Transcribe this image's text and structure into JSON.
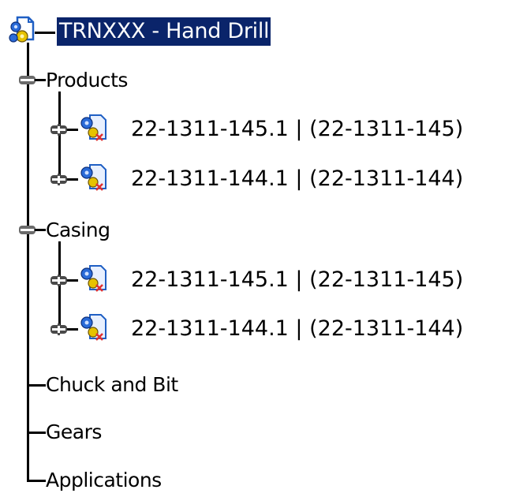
{
  "root": {
    "label": "TRNXXX - Hand Drill",
    "icon": "product-document-icon",
    "selected": true
  },
  "nodes": [
    {
      "label": "Products",
      "expander": "collapse",
      "children": [
        {
          "label": "22-1311-145.1 | (22-1311-145)",
          "icon": "part-instance-icon",
          "expander": "expand"
        },
        {
          "label": "22-1311-144.1 | (22-1311-144)",
          "icon": "part-instance-icon",
          "expander": "expand"
        }
      ]
    },
    {
      "label": "Casing",
      "expander": "collapse",
      "children": [
        {
          "label": "22-1311-145.1 | (22-1311-145)",
          "icon": "part-instance-icon",
          "expander": "expand"
        },
        {
          "label": "22-1311-144.1 | (22-1311-144)",
          "icon": "part-instance-icon",
          "expander": "expand"
        }
      ]
    },
    {
      "label": "Chuck and Bit"
    },
    {
      "label": "Gears"
    },
    {
      "label": "Applications"
    }
  ],
  "colors": {
    "selection": "#0a246a",
    "expander": "#6b6b6b",
    "icon_blue": "#2a6bd8",
    "icon_yellow": "#e6c200",
    "icon_red": "#e03030"
  }
}
